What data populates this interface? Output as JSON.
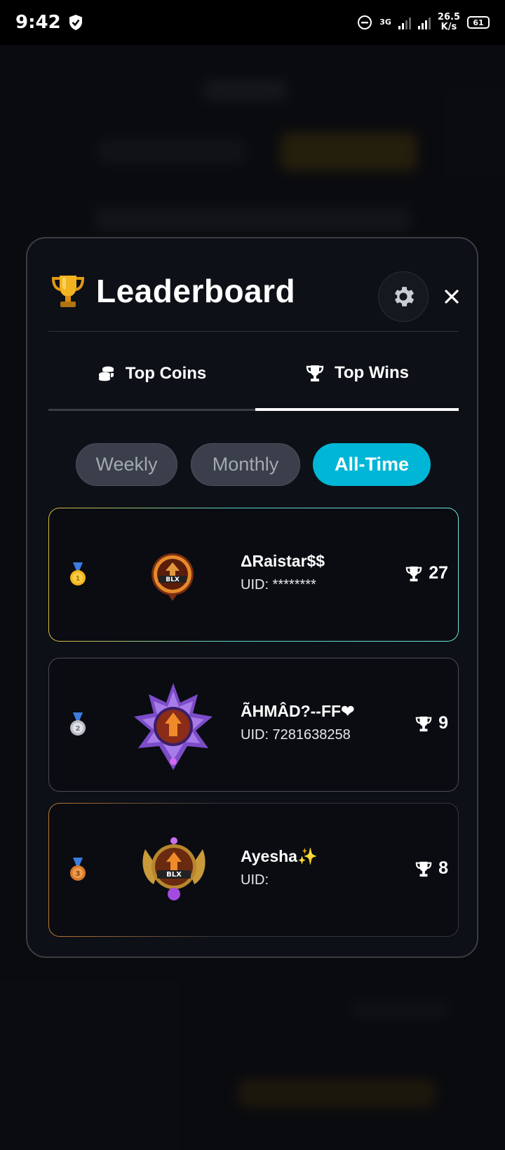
{
  "status_bar": {
    "time": "9:42",
    "network_type": "3G",
    "speed_value": "26.5",
    "speed_unit": "K/s",
    "battery": "61"
  },
  "leaderboard": {
    "title": "Leaderboard",
    "tabs": [
      {
        "label": "Top Coins",
        "icon": "coins-icon",
        "active": false
      },
      {
        "label": "Top Wins",
        "icon": "trophy-icon",
        "active": true
      }
    ],
    "periods": [
      {
        "label": "Weekly",
        "active": false
      },
      {
        "label": "Monthly",
        "active": false
      },
      {
        "label": "All-Time",
        "active": true
      }
    ],
    "entries": [
      {
        "rank": 1,
        "medal": "gold-medal-icon",
        "name": "ΔRaistar$$",
        "uid": "UID: ********",
        "wins": "27"
      },
      {
        "rank": 2,
        "medal": "silver-medal-icon",
        "name": "ÃHMÂD?--FF❤",
        "uid": "UID: 7281638258",
        "wins": "9"
      },
      {
        "rank": 3,
        "medal": "bronze-medal-icon",
        "name": "Ayesha✨",
        "uid": "UID:",
        "wins": "8"
      }
    ]
  },
  "colors": {
    "accent": "#00b6d6",
    "modal_bg": "#0d1016",
    "gold": "#f0b400",
    "silver": "#c0c4cc",
    "bronze": "#d9792b"
  }
}
